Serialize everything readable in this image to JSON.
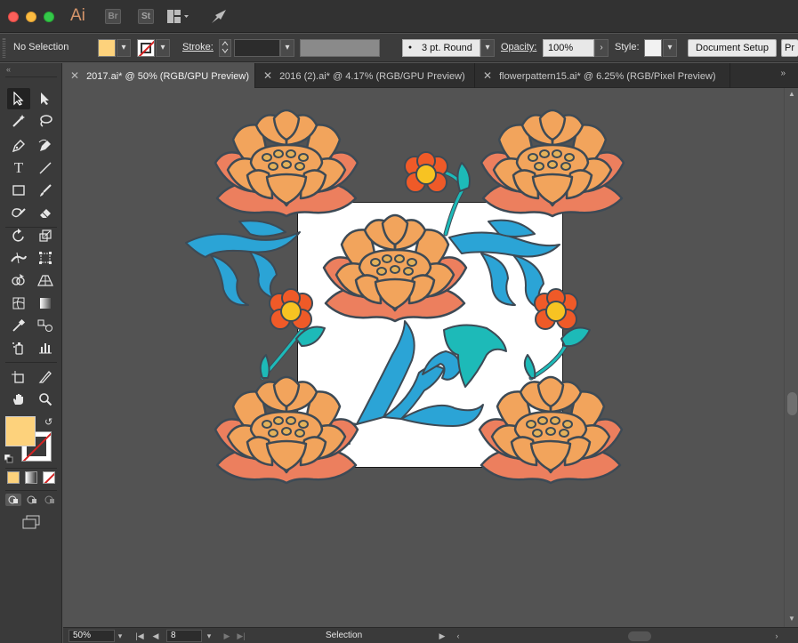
{
  "app": {
    "logo": "Ai",
    "bridge_badge": "Br",
    "stock_badge": "St"
  },
  "controlbar": {
    "selection_status": "No Selection",
    "stroke_label": "Stroke:",
    "stroke_weight": "",
    "brush_definition": "3 pt. Round",
    "opacity_label": "Opacity:",
    "opacity_value": "100%",
    "style_label": "Style:",
    "document_setup_label": "Document Setup",
    "preferences_label": "Pr"
  },
  "colors": {
    "fill": "#fdd27c",
    "stroke": "none",
    "petal_orange": "#f2a45c",
    "petal_salmon": "#ec7f5e",
    "leaf_blue": "#2ba4d6",
    "leaf_teal": "#1dbab8",
    "poppy_red": "#ef5a28",
    "poppy_center": "#f7c322",
    "outline": "#3d4a55"
  },
  "tabs": [
    {
      "label": "2017.ai* @ 50% (RGB/GPU Preview)",
      "active": true
    },
    {
      "label": "2016 (2).ai* @ 4.17% (RGB/GPU Preview)",
      "active": false
    },
    {
      "label": "flowerpattern15.ai* @ 6.25% (RGB/Pixel Preview)",
      "active": false
    }
  ],
  "tools": [
    "selection-tool",
    "direct-selection-tool",
    "magic-wand-tool",
    "lasso-tool",
    "pen-tool",
    "curvature-tool",
    "type-tool",
    "line-segment-tool",
    "rectangle-tool",
    "paintbrush-tool",
    "shaper-tool",
    "eraser-tool",
    "rotate-tool",
    "scale-tool",
    "width-tool",
    "free-transform-tool",
    "shape-builder-tool",
    "perspective-grid-tool",
    "mesh-tool",
    "gradient-tool",
    "eyedropper-tool",
    "blend-tool",
    "symbol-sprayer-tool",
    "column-graph-tool",
    "artboard-tool",
    "slice-tool",
    "hand-tool",
    "zoom-tool"
  ],
  "status": {
    "zoom": "50%",
    "artboard_number": "8",
    "current_tool": "Selection"
  }
}
